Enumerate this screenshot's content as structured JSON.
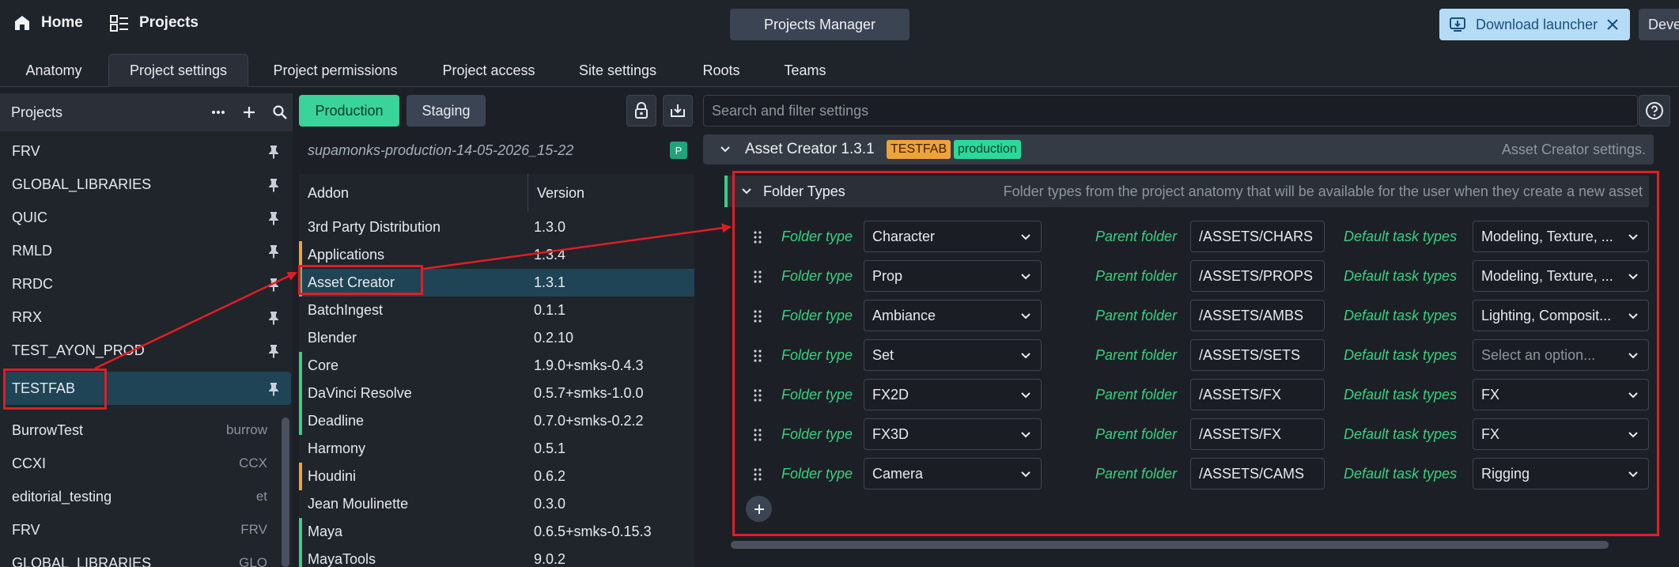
{
  "topbar": {
    "home_label": "Home",
    "projects_label": "Projects",
    "title": "Projects Manager",
    "download_label": "Download launcher",
    "dev_label": "Deve"
  },
  "tabs": [
    "Anatomy",
    "Project settings",
    "Project permissions",
    "Project access",
    "Site settings",
    "Roots",
    "Teams"
  ],
  "projects_panel": {
    "title": "Projects",
    "pinned": [
      "FRV",
      "GLOBAL_LIBRARIES",
      "QUIC",
      "RMLD",
      "RRDC",
      "RRX",
      "TEST_AYON_PROD",
      "TESTFAB"
    ],
    "selected": "TESTFAB",
    "others": [
      {
        "name": "BurrowTest",
        "code": "burrow"
      },
      {
        "name": "CCXI",
        "code": "CCX"
      },
      {
        "name": "editorial_testing",
        "code": "et"
      },
      {
        "name": "FRV",
        "code": "FRV"
      },
      {
        "name": "GLOBAL_LIBRARIES",
        "code": "GLO"
      }
    ]
  },
  "bundle_panel": {
    "production_label": "Production",
    "staging_label": "Staging",
    "bundle_name": "supamonks-production-14-05-2026_15-22",
    "bundle_badge": "P",
    "col_addon": "Addon",
    "col_version": "Version",
    "addons": [
      {
        "name": "3rd Party Distribution",
        "version": "1.3.0",
        "mark": ""
      },
      {
        "name": "Applications",
        "version": "1.3.4",
        "mark": "#f0a23a"
      },
      {
        "name": "Asset Creator",
        "version": "1.3.1",
        "mark": "#3ad07e"
      },
      {
        "name": "BatchIngest",
        "version": "0.1.1",
        "mark": ""
      },
      {
        "name": "Blender",
        "version": "0.2.10",
        "mark": ""
      },
      {
        "name": "Core",
        "version": "1.9.0+smks-0.4.3",
        "mark": "#3ad07e"
      },
      {
        "name": "DaVinci Resolve",
        "version": "0.5.7+smks-1.0.0",
        "mark": "#3ad07e"
      },
      {
        "name": "Deadline",
        "version": "0.7.0+smks-0.2.2",
        "mark": "#3ad07e"
      },
      {
        "name": "Harmony",
        "version": "0.5.1",
        "mark": ""
      },
      {
        "name": "Houdini",
        "version": "0.6.2",
        "mark": "#f0a23a"
      },
      {
        "name": "Jean Moulinette",
        "version": "0.3.0",
        "mark": ""
      },
      {
        "name": "Maya",
        "version": "0.6.5+smks-0.15.3",
        "mark": "#3ad07e"
      },
      {
        "name": "MayaTools",
        "version": "9.0.2",
        "mark": "#3ad07e"
      }
    ],
    "selected_addon": "Asset Creator"
  },
  "settings_panel": {
    "search_placeholder": "Search and filter settings",
    "addon_title": "Asset Creator 1.3.1",
    "tag_project": "TESTFAB",
    "tag_env": "production",
    "addon_desc": "Asset Creator settings.",
    "section_title": "Folder Types",
    "section_desc": "Folder types from the project anatomy that will be available for the user when they create a new asset",
    "label_folder_type": "Folder type",
    "label_parent_folder": "Parent folder",
    "label_task_types": "Default task types",
    "task_placeholder": "Select an option...",
    "rows": [
      {
        "folder_type": "Character",
        "parent": "/ASSETS/CHARS",
        "tasks": "Modeling, Texture, ..."
      },
      {
        "folder_type": "Prop",
        "parent": "/ASSETS/PROPS",
        "tasks": "Modeling, Texture, ..."
      },
      {
        "folder_type": "Ambiance",
        "parent": "/ASSETS/AMBS",
        "tasks": "Lighting, Composit..."
      },
      {
        "folder_type": "Set",
        "parent": "/ASSETS/SETS",
        "tasks": ""
      },
      {
        "folder_type": "FX2D",
        "parent": "/ASSETS/FX",
        "tasks": "FX"
      },
      {
        "folder_type": "FX3D",
        "parent": "/ASSETS/FX",
        "tasks": "FX"
      },
      {
        "folder_type": "Camera",
        "parent": "/ASSETS/CAMS",
        "tasks": "Rigging"
      }
    ]
  },
  "colors": {
    "accent_green": "#3ad39a",
    "label_green": "#3ad07e",
    "annotation_red": "#e01d25",
    "selection": "#1f4455"
  },
  "icons": [
    "home-icon",
    "projects-icon",
    "download-icon",
    "close-icon",
    "more-icon",
    "plus-icon",
    "search-icon",
    "pin-icon",
    "lock-icon",
    "import-icon",
    "help-icon",
    "chevron-down-icon",
    "drag-handle-icon"
  ]
}
